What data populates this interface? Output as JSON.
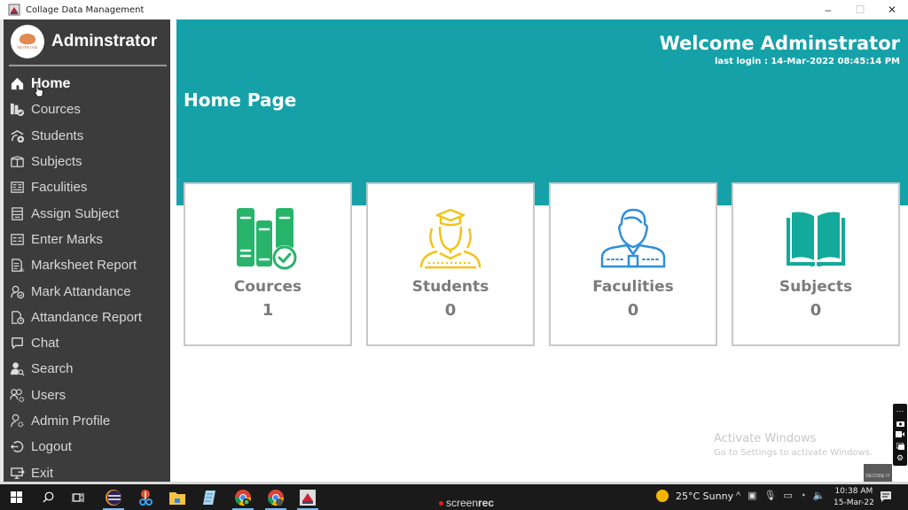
{
  "window": {
    "title": "Collage Data Management",
    "controls": {
      "minimize": "–",
      "maximize": "☐",
      "close": "✕"
    }
  },
  "sidebar": {
    "user_name": "Adminstrator",
    "logo": {
      "brand": "SILVER OAK",
      "sub": "College of Engineering"
    },
    "items": [
      {
        "label": "Home",
        "icon": "home-icon",
        "active": true
      },
      {
        "label": "Cources",
        "icon": "courses-icon"
      },
      {
        "label": "Students",
        "icon": "students-icon"
      },
      {
        "label": "Subjects",
        "icon": "subjects-icon"
      },
      {
        "label": "Faculities",
        "icon": "faculties-icon"
      },
      {
        "label": "Assign Subject",
        "icon": "assign-subject-icon"
      },
      {
        "label": "Enter Marks",
        "icon": "enter-marks-icon"
      },
      {
        "label": "Marksheet Report",
        "icon": "marksheet-report-icon"
      },
      {
        "label": "Mark Attandance",
        "icon": "mark-attendance-icon"
      },
      {
        "label": "Attandance Report",
        "icon": "attendance-report-icon"
      },
      {
        "label": "Chat",
        "icon": "chat-icon"
      },
      {
        "label": "Search",
        "icon": "search-user-icon"
      },
      {
        "label": "Users",
        "icon": "users-settings-icon"
      },
      {
        "label": "Admin Profile",
        "icon": "admin-profile-icon"
      },
      {
        "label": "Logout",
        "icon": "logout-icon"
      },
      {
        "label": "Exit",
        "icon": "exit-icon"
      }
    ]
  },
  "header": {
    "welcome": "Welcome Adminstrator",
    "last_login": "last login : 14-Mar-2022 08:45:14 PM",
    "page_title": "Home Page",
    "color": "#16a1a8"
  },
  "cards": [
    {
      "label": "Cources",
      "count": "1",
      "icon": "books-check-icon",
      "color": "#27b46a"
    },
    {
      "label": "Students",
      "count": "0",
      "icon": "graduate-students-icon",
      "color": "#f2c318"
    },
    {
      "label": "Faculities",
      "count": "0",
      "icon": "faculty-person-icon",
      "color": "#2f8fd8"
    },
    {
      "label": "Subjects",
      "count": "0",
      "icon": "open-book-icon",
      "color": "#13a99b"
    }
  ],
  "watermark": {
    "line1": "Activate Windows",
    "line2": "Go to Settings to activate Windows."
  },
  "decode_badge": "DECODE IT",
  "taskbar": {
    "recorder_label_a": "screen",
    "recorder_label_b": "rec",
    "weather": "25°C  Sunny",
    "time": "10:38 AM",
    "date": "15-Mar-22"
  }
}
